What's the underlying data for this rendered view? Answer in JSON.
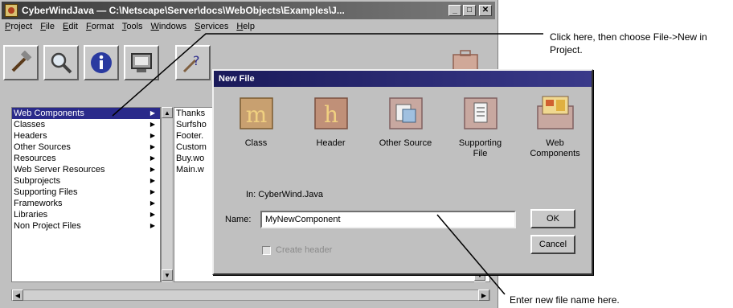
{
  "window": {
    "title": "CyberWindJava  —  C:\\Netscape\\Server\\docs\\WebObjects\\Examples\\J...",
    "menu": [
      "Project",
      "File",
      "Edit",
      "Format",
      "Tools",
      "Windows",
      "Services",
      "Help"
    ]
  },
  "toolbar": {
    "tools": [
      "build-tool",
      "find-tool",
      "inspector-tool",
      "launcher-tool",
      "help-tool"
    ]
  },
  "browser": {
    "categories": [
      {
        "label": "Web Components"
      },
      {
        "label": "Classes"
      },
      {
        "label": "Headers"
      },
      {
        "label": "Other Sources"
      },
      {
        "label": "Resources"
      },
      {
        "label": "Web Server Resources"
      },
      {
        "label": "Subprojects"
      },
      {
        "label": "Supporting Files"
      },
      {
        "label": "Frameworks"
      },
      {
        "label": "Libraries"
      },
      {
        "label": "Non Project Files"
      }
    ],
    "files": [
      "Thanks",
      "Surfsho",
      "Footer.",
      "Custom",
      "Buy.wo",
      "Main.w"
    ]
  },
  "dialog": {
    "title": "New File",
    "types": [
      {
        "label": "Class",
        "letter": "m"
      },
      {
        "label": "Header",
        "letter": "h"
      },
      {
        "label": "Other Source",
        "letter": ""
      },
      {
        "label": "Supporting\nFile",
        "letter": ""
      },
      {
        "label": "Web\nComponents",
        "letter": ""
      }
    ],
    "in_label": "In: CyberWind.Java",
    "name_label": "Name:",
    "name_value": "MyNewComponent",
    "ok_label": "OK",
    "cancel_label": "Cancel",
    "create_header_label": "Create header"
  },
  "callouts": {
    "top": "Click here, then choose File->New in Project.",
    "bottom": "Enter new file name here."
  }
}
